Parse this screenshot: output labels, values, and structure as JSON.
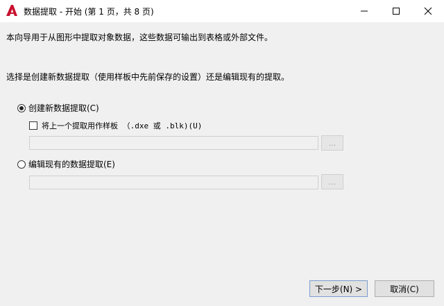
{
  "window": {
    "title": "数据提取 - 开始 (第 1 页，共 8 页)",
    "icons": {
      "app": "autocad-a-icon",
      "minimize": "minimize-icon",
      "maximize": "maximize-icon",
      "close": "close-icon"
    },
    "accent_color": "#c8102e"
  },
  "intro": {
    "line1": "本向导用于从图形中提取对象数据，这些数据可输出到表格或外部文件。",
    "line2": "选择是创建新数据提取（使用样板中先前保存的设置）还是编辑现有的提取。"
  },
  "options": {
    "create_new": {
      "label": "创建新数据提取(C)",
      "selected": true
    },
    "use_template": {
      "label": "将上一个提取用作样板 （.dxe 或 .blk)(U)",
      "checked": false,
      "field_value": "",
      "browse_label": "..."
    },
    "edit_existing": {
      "label": "编辑现有的数据提取(E)",
      "selected": false,
      "field_value": "",
      "browse_label": "..."
    }
  },
  "footer": {
    "next_label": "下一步(N) >",
    "cancel_label": "取消(C)"
  }
}
